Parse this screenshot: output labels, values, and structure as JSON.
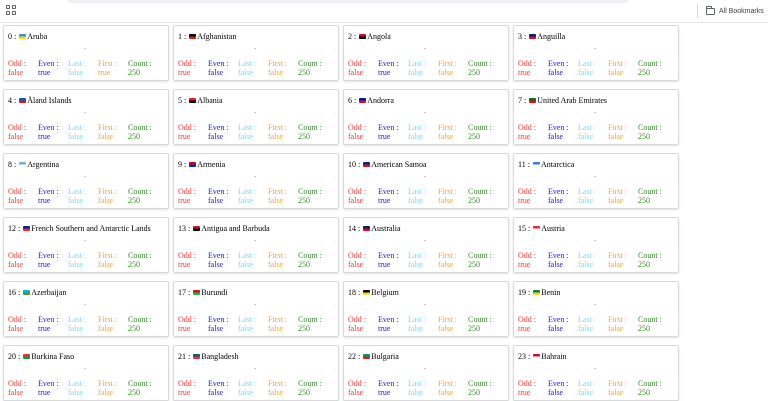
{
  "browser": {
    "bookmarks_label": "All Bookmarks"
  },
  "labels": {
    "sep": " : ",
    "odd": "Odd :",
    "even": "Even :",
    "last": "Last :",
    "first": "First :",
    "count": "Count :"
  },
  "cards": [
    {
      "index": "0",
      "name": "Aruba",
      "odd": "false",
      "even": "true",
      "last": "false",
      "first": "true",
      "count": "250",
      "flag_colors": [
        "#4189dd",
        "#f9d616"
      ]
    },
    {
      "index": "1",
      "name": "Afghanistan",
      "odd": "true",
      "even": "false",
      "last": "false",
      "first": "false",
      "count": "250",
      "flag_colors": [
        "#000000",
        "#d32011"
      ]
    },
    {
      "index": "2",
      "name": "Angola",
      "odd": "false",
      "even": "true",
      "last": "false",
      "first": "false",
      "count": "250",
      "flag_colors": [
        "#cc092f",
        "#000000"
      ]
    },
    {
      "index": "3",
      "name": "Anguilla",
      "odd": "true",
      "even": "false",
      "last": "false",
      "first": "false",
      "count": "250",
      "flag_colors": [
        "#012169",
        "#c8102e"
      ]
    },
    {
      "index": "4",
      "name": "Åland Islands",
      "odd": "false",
      "even": "true",
      "last": "false",
      "first": "false",
      "count": "250",
      "flag_colors": [
        "#0064ad",
        "#d21034"
      ]
    },
    {
      "index": "5",
      "name": "Albania",
      "odd": "true",
      "even": "false",
      "last": "false",
      "first": "false",
      "count": "250",
      "flag_colors": [
        "#e41e20",
        "#000000"
      ]
    },
    {
      "index": "6",
      "name": "Andorra",
      "odd": "false",
      "even": "true",
      "last": "false",
      "first": "false",
      "count": "250",
      "flag_colors": [
        "#0018a8",
        "#d0103a"
      ]
    },
    {
      "index": "7",
      "name": "United Arab Emirates",
      "odd": "true",
      "even": "false",
      "last": "false",
      "first": "false",
      "count": "250",
      "flag_colors": [
        "#00732f",
        "#ff0000"
      ]
    },
    {
      "index": "8",
      "name": "Argentina",
      "odd": "false",
      "even": "true",
      "last": "false",
      "first": "false",
      "count": "250",
      "flag_colors": [
        "#74acdf",
        "#ffffff"
      ]
    },
    {
      "index": "9",
      "name": "Armenia",
      "odd": "true",
      "even": "false",
      "last": "false",
      "first": "false",
      "count": "250",
      "flag_colors": [
        "#d90012",
        "#0033a0"
      ]
    },
    {
      "index": "10",
      "name": "American Samoa",
      "odd": "false",
      "even": "true",
      "last": "false",
      "first": "false",
      "count": "250",
      "flag_colors": [
        "#002b7f",
        "#ce1126"
      ]
    },
    {
      "index": "11",
      "name": "Antarctica",
      "odd": "true",
      "even": "false",
      "last": "false",
      "first": "false",
      "count": "250",
      "flag_colors": [
        "#3a7dce",
        "#ffffff"
      ]
    },
    {
      "index": "12",
      "name": "French Southern and Antarctic Lands",
      "odd": "false",
      "even": "true",
      "last": "false",
      "first": "false",
      "count": "250",
      "flag_colors": [
        "#002395",
        "#ed2939"
      ]
    },
    {
      "index": "13",
      "name": "Antigua and Barbuda",
      "odd": "true",
      "even": "false",
      "last": "false",
      "first": "false",
      "count": "250",
      "flag_colors": [
        "#ce1126",
        "#000000"
      ]
    },
    {
      "index": "14",
      "name": "Australia",
      "odd": "false",
      "even": "true",
      "last": "false",
      "first": "false",
      "count": "250",
      "flag_colors": [
        "#012169",
        "#e4002b"
      ]
    },
    {
      "index": "15",
      "name": "Austria",
      "odd": "true",
      "even": "false",
      "last": "false",
      "first": "false",
      "count": "250",
      "flag_colors": [
        "#ed2939",
        "#ffffff"
      ]
    },
    {
      "index": "16",
      "name": "Azerbaijan",
      "odd": "false",
      "even": "true",
      "last": "false",
      "first": "false",
      "count": "250",
      "flag_colors": [
        "#00b5e2",
        "#3f9c35"
      ]
    },
    {
      "index": "17",
      "name": "Burundi",
      "odd": "true",
      "even": "false",
      "last": "false",
      "first": "false",
      "count": "250",
      "flag_colors": [
        "#ce1126",
        "#1eb53a"
      ]
    },
    {
      "index": "18",
      "name": "Belgium",
      "odd": "false",
      "even": "true",
      "last": "false",
      "first": "false",
      "count": "250",
      "flag_colors": [
        "#000000",
        "#fdda24"
      ]
    },
    {
      "index": "19",
      "name": "Benin",
      "odd": "true",
      "even": "false",
      "last": "false",
      "first": "false",
      "count": "250",
      "flag_colors": [
        "#008751",
        "#fcd116"
      ]
    },
    {
      "index": "20",
      "name": "Burkina Faso",
      "odd": "false",
      "even": "true",
      "last": "false",
      "first": "false",
      "count": "250",
      "flag_colors": [
        "#ef2b2d",
        "#009e49"
      ]
    },
    {
      "index": "21",
      "name": "Bangladesh",
      "odd": "true",
      "even": "false",
      "last": "false",
      "first": "false",
      "count": "250",
      "flag_colors": [
        "#006a4e",
        "#f42a41"
      ]
    },
    {
      "index": "22",
      "name": "Bulgaria",
      "odd": "false",
      "even": "true",
      "last": "false",
      "first": "false",
      "count": "250",
      "flag_colors": [
        "#00966e",
        "#d62612"
      ]
    },
    {
      "index": "23",
      "name": "Bahrain",
      "odd": "true",
      "even": "false",
      "last": "false",
      "first": "false",
      "count": "250",
      "flag_colors": [
        "#ce1126",
        "#ffffff"
      ]
    }
  ]
}
